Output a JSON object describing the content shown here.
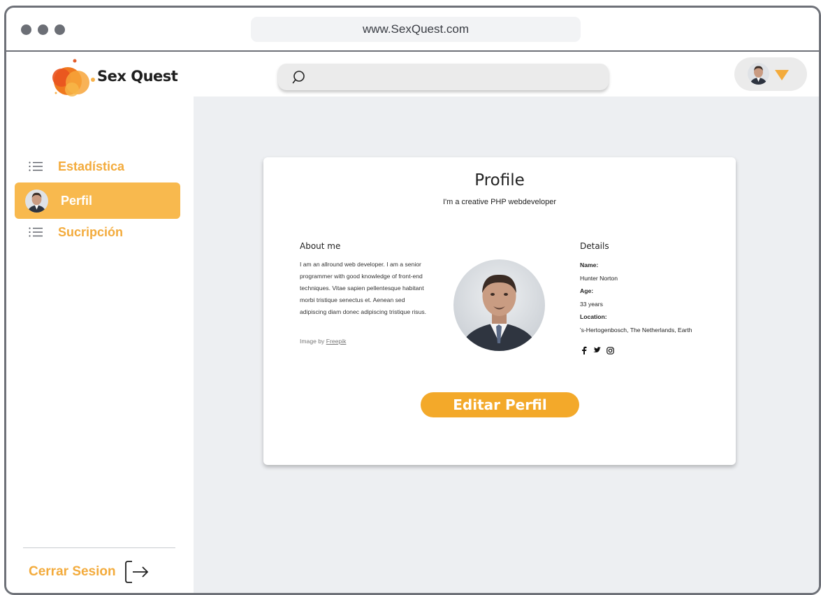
{
  "browser": {
    "url": "www.SexQuest.com"
  },
  "app": {
    "name": "Sex Quest"
  },
  "icons": {
    "list": "list-icon",
    "search": "search-icon",
    "logout": "logout-arrow-icon",
    "caret": "caret-down-icon",
    "social": [
      "facebook-icon",
      "twitter-icon",
      "instagram-icon"
    ]
  },
  "colors": {
    "accent": "#f3ab3c",
    "active_bg": "#f8b94e",
    "button": "#f3a92a",
    "main_bg": "#edeff2"
  },
  "sidebar": {
    "items": [
      {
        "label": "Estadística",
        "active": false
      },
      {
        "label": "Perfil",
        "active": true
      },
      {
        "label": "Sucripción",
        "active": false
      }
    ],
    "logout_label": "Cerrar Sesion"
  },
  "profile": {
    "title": "Profile",
    "subtitle": "I'm a creative PHP webdeveloper",
    "about": {
      "heading": "About me",
      "text": "I am an allround web developer. I am a senior programmer with good knowledge of front-end techniques. Vitae sapien pellentesque habitant morbi tristique senectus et. Aenean sed adipiscing diam donec adipiscing tristique risus.",
      "credit_prefix": "Image by",
      "credit_link": "Freepik"
    },
    "details": {
      "heading": "Details",
      "name_label": "Name:",
      "name": "Hunter Norton",
      "age_label": "Age:",
      "age": "33 years",
      "location_label": "Location:",
      "location": "'s-Hertogenbosch, The Netherlands, Earth"
    },
    "edit_button": "Editar Perfil"
  }
}
